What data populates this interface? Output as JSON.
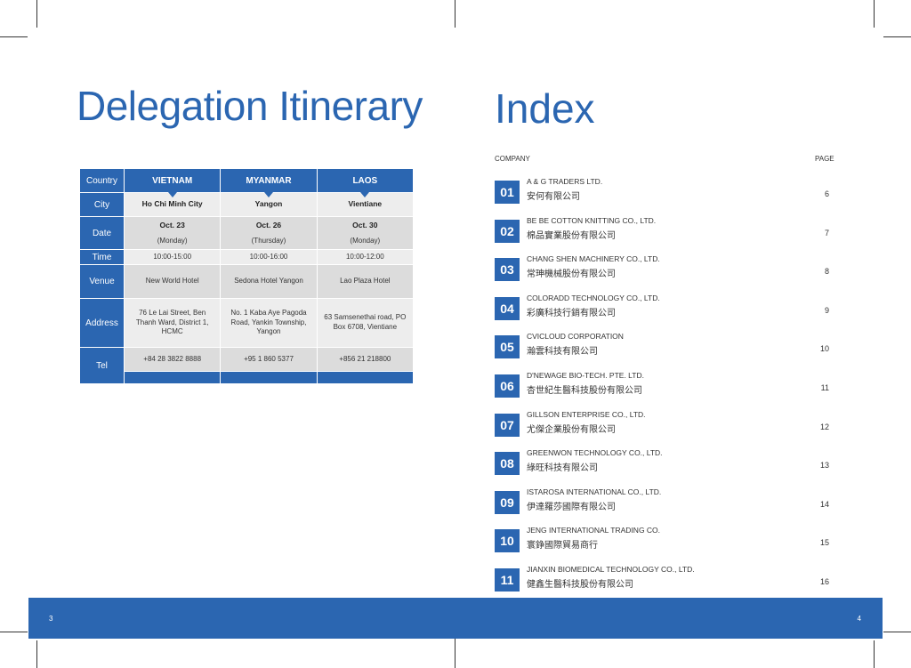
{
  "left": {
    "title": "Delegation Itinerary",
    "row_labels": {
      "country": "Country",
      "city": "City",
      "date": "Date",
      "time": "Time",
      "venue": "Venue",
      "address": "Address",
      "tel": "Tel"
    },
    "columns": [
      {
        "country": "VIETNAM",
        "city": "Ho Chi Minh City",
        "date": "Oct. 23",
        "weekday": "(Monday)",
        "time": "10:00-15:00",
        "venue": "New World Hotel",
        "address": "76 Le Lai Street, Ben Thanh Ward, District 1, HCMC",
        "tel": "+84 28 3822 8888"
      },
      {
        "country": "MYANMAR",
        "city": "Yangon",
        "date": "Oct. 26",
        "weekday": "(Thursday)",
        "time": "10:00-16:00",
        "venue": "Sedona Hotel Yangon",
        "address": "No. 1 Kaba Aye Pagoda Road, Yankin Township, Yangon",
        "tel": "+95 1 860 5377"
      },
      {
        "country": "LAOS",
        "city": "Vientiane",
        "date": "Oct. 30",
        "weekday": "(Monday)",
        "time": "10:00-12:00",
        "venue": "Lao Plaza Hotel",
        "address": "63 Samsenethai road, PO Box 6708, Vientiane",
        "tel": "+856 21 218800"
      }
    ],
    "page_number": "3"
  },
  "right": {
    "title": "Index",
    "col_company": "COMPANY",
    "col_page": "PAGE",
    "entries": [
      {
        "num": "01",
        "en": "A & G TRADERS LTD.",
        "zh": "安何有限公司",
        "page": "6"
      },
      {
        "num": "02",
        "en": "BE BE COTTON KNITTING CO., LTD.",
        "zh": "棉品實業股份有限公司",
        "page": "7"
      },
      {
        "num": "03",
        "en": "CHANG SHEN MACHINERY CO., LTD.",
        "zh": "常珅機械股份有限公司",
        "page": "8"
      },
      {
        "num": "04",
        "en": "COLORADD TECHNOLOGY CO., LTD.",
        "zh": "彩廣科技行銷有限公司",
        "page": "9"
      },
      {
        "num": "05",
        "en": "CVICLOUD CORPORATION",
        "zh": "瀚雲科技有限公司",
        "page": "10"
      },
      {
        "num": "06",
        "en": "D'NEWAGE BIO-TECH. PTE. LTD.",
        "zh": "杏世紀生醫科技股份有限公司",
        "page": "11"
      },
      {
        "num": "07",
        "en": "GILLSON ENTERPRISE CO., LTD.",
        "zh": "尤傑企業股份有限公司",
        "page": "12"
      },
      {
        "num": "08",
        "en": "GREENWON TECHNOLOGY CO., LTD.",
        "zh": "綠旺科技有限公司",
        "page": "13"
      },
      {
        "num": "09",
        "en": "ISTAROSA INTERNATIONAL CO., LTD.",
        "zh": "伊達羅莎國際有限公司",
        "page": "14"
      },
      {
        "num": "10",
        "en": "JENG INTERNATIONAL TRADING CO.",
        "zh": "寰錚國際貿易商行",
        "page": "15"
      },
      {
        "num": "11",
        "en": "JIANXIN BIOMEDICAL TECHNOLOGY CO., LTD.",
        "zh": "健鑫生醫科技股份有限公司",
        "page": "16"
      }
    ],
    "page_number": "4"
  },
  "colors": {
    "brand_blue": "#2b66b1",
    "cell_light": "#ededed",
    "cell_dark": "#dcdcdc"
  }
}
